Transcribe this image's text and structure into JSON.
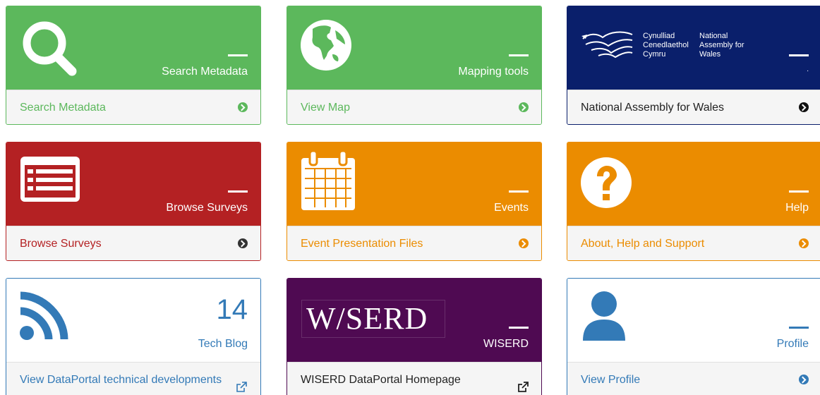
{
  "tiles": {
    "search": {
      "heading": "Search Metadata",
      "link": "Search Metadata",
      "icon": "search-icon"
    },
    "mapping": {
      "heading": "Mapping tools",
      "link": "View Map",
      "icon": "globe-icon"
    },
    "assembly": {
      "logo_welsh": [
        "Cynulliad",
        "Cenedlaethol",
        "Cymru"
      ],
      "logo_english": [
        "National",
        "Assembly for",
        "Wales"
      ],
      "heading": ".",
      "link": "National Assembly for Wales",
      "icon": "dragon-logo-icon"
    },
    "surveys": {
      "heading": "Browse Surveys",
      "link": "Browse Surveys",
      "icon": "list-icon"
    },
    "events": {
      "heading": "Events",
      "link": "Event Presentation Files",
      "icon": "calendar-icon"
    },
    "help": {
      "heading": "Help",
      "link": "About, Help and Support",
      "icon": "question-icon"
    },
    "blog": {
      "count": "14",
      "heading": "Tech Blog",
      "link": "View DataPortal technical developments",
      "icon": "rss-icon"
    },
    "wiserd": {
      "logo": "W/SERD",
      "heading": "WISERD",
      "link": "WISERD DataPortal Homepage",
      "icon": "wiserd-logo"
    },
    "profile": {
      "heading": "Profile",
      "link": "View Profile",
      "icon": "user-icon"
    }
  },
  "colors": {
    "green": "#5cb85c",
    "navy": "#0a1f6b",
    "red": "#b42123",
    "orange": "#eb8c00",
    "blue": "#337ab7",
    "purple": "#4f0a52"
  }
}
